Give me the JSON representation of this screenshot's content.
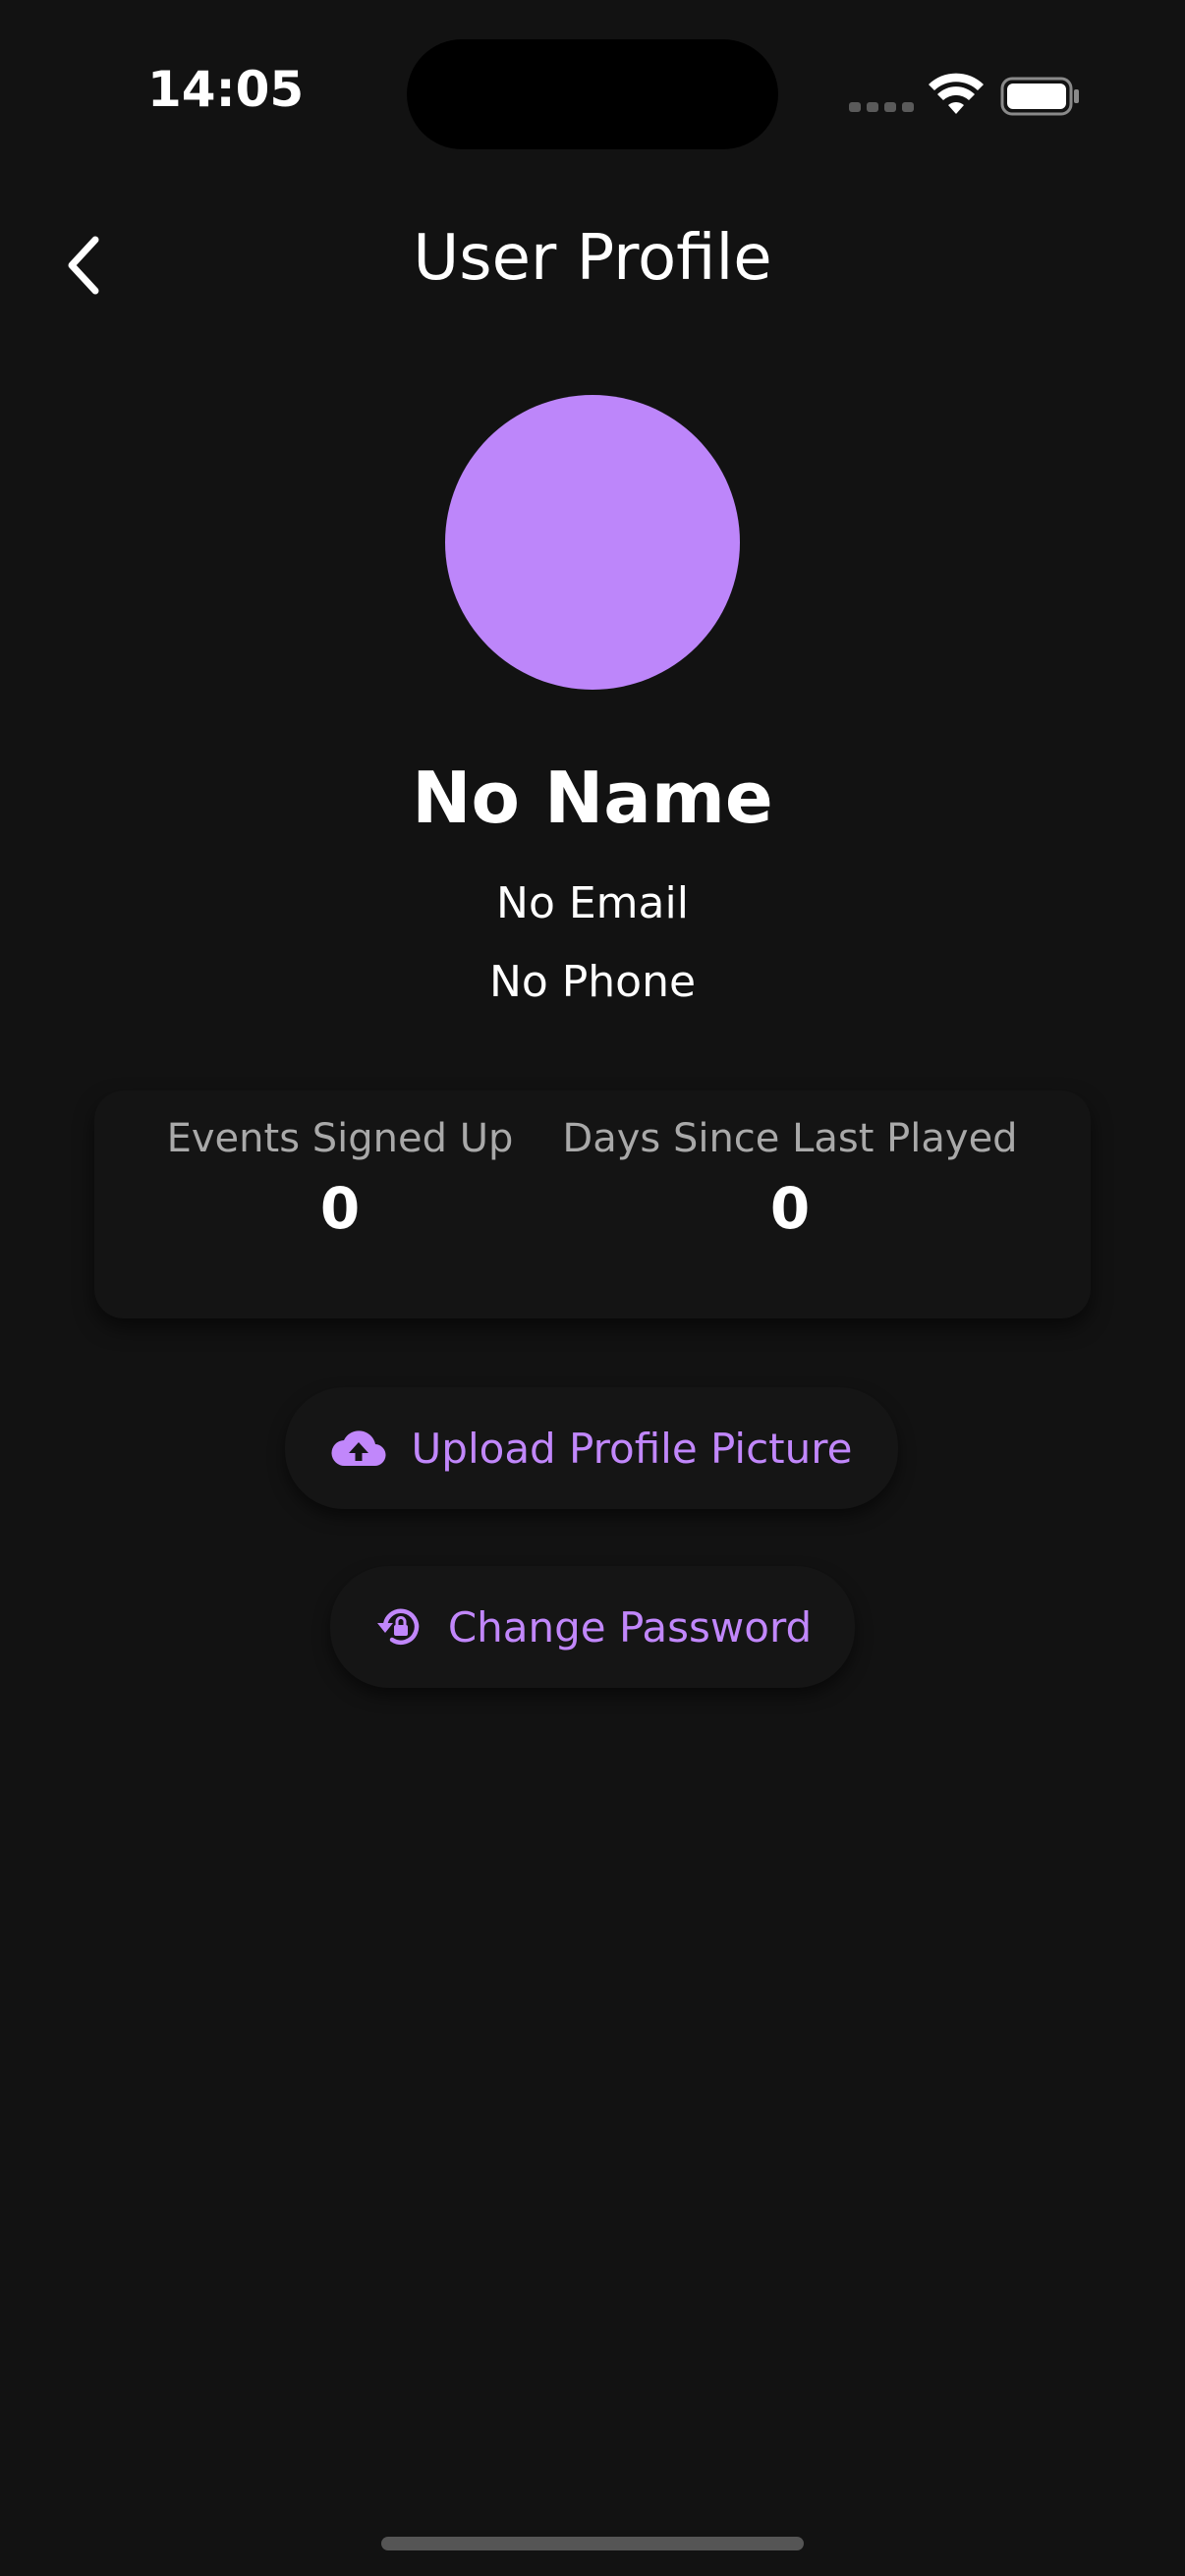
{
  "status_bar": {
    "time": "14:05"
  },
  "app_bar": {
    "title": "User Profile",
    "back_icon": "chevron-left-icon"
  },
  "profile": {
    "avatar_color": "#bd86fa",
    "name": "No Name",
    "email": "No Email",
    "phone": "No Phone"
  },
  "stats": [
    {
      "label": "Events Signed Up",
      "value": "0"
    },
    {
      "label": "Days Since Last Played",
      "value": "0"
    }
  ],
  "actions": {
    "upload": {
      "label": "Upload Profile Picture",
      "icon": "cloud-upload-icon"
    },
    "password": {
      "label": "Change Password",
      "icon": "lock-reset-icon"
    }
  },
  "colors": {
    "background": "#121212",
    "accent": "#c187fb",
    "text": "#ffffff",
    "muted": "#a9a9a9"
  }
}
